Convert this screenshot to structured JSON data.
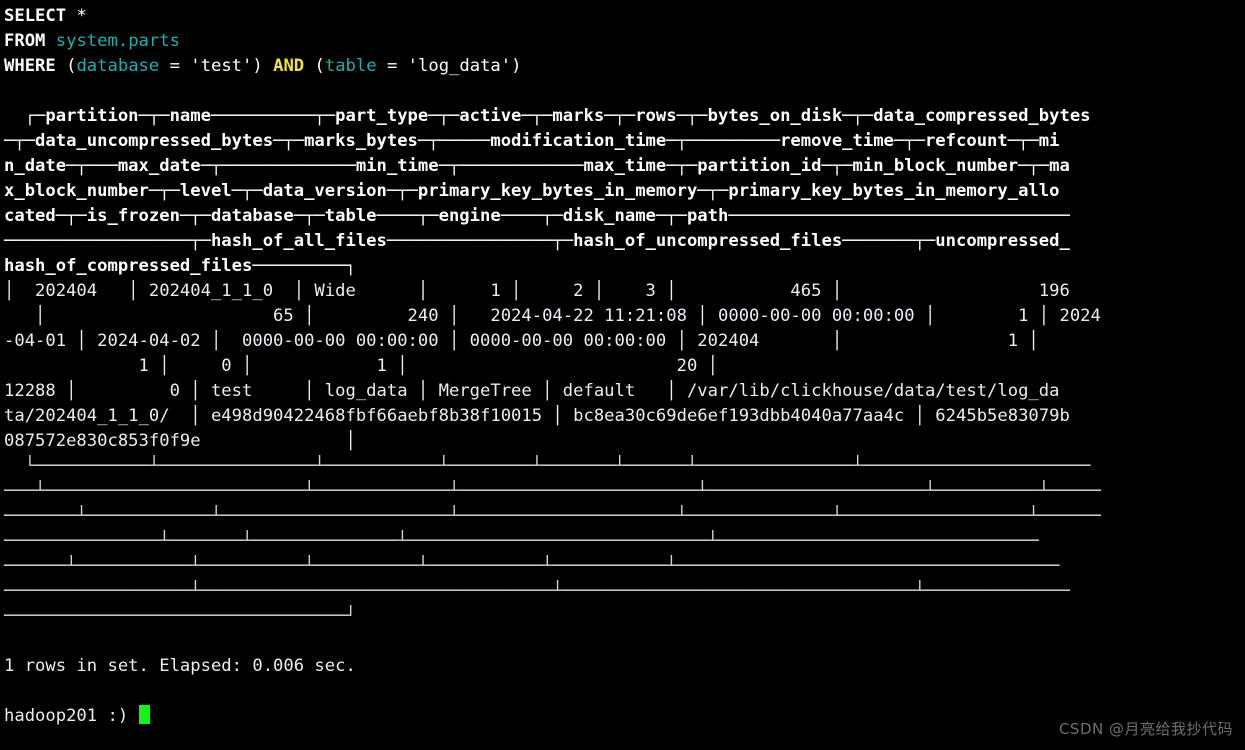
{
  "terminal": {
    "background_color": "#000000",
    "foreground_color": "#e6e6e6",
    "cursor_color": "#12f712",
    "keyword_color": "#ffffff",
    "identifier_color": "#19b0b0",
    "operator_color": "#f2e43c",
    "number_color": "#c9d6e8"
  },
  "query": {
    "line1": {
      "keyword": "SELECT",
      "rest": " *"
    },
    "line2": {
      "keyword": "FROM",
      "table": "system.parts"
    },
    "line3": {
      "keyword": "WHERE",
      "open1": " (",
      "col1": "database",
      "eq1": " = 'test')",
      "and": "AND",
      "open2": "(",
      "col2": "table",
      "eq2": " = 'log_data')"
    }
  },
  "result_header": {
    "line1": "  ┌─partition─┬─name──────────┬─part_type─┬─active─┬─marks─┬─rows─┬─bytes_on_disk─┬─data_compressed_bytes",
    "line2": "─┬─data_uncompressed_bytes─┬─marks_bytes─┬─────modification_time─┬─────────remove_time─┬─refcount─┬─mi",
    "line3": "n_date─┬───max_date─┬─────────────min_time─┬────────────max_time─┬─partition_id─┬─min_block_number─┬─ma",
    "line4": "x_block_number─┬─level─┬─data_version─┬─primary_key_bytes_in_memory─┬─primary_key_bytes_in_memory_allo",
    "line5": "cated─┬─is_frozen─┬─database─┬─table────┬─engine────┬─disk_name─┬─path─────────────────────────────────",
    "line6": "──────────────────┬─hash_of_all_files────────────────┬─hash_of_uncompressed_files───────┬─uncompressed_",
    "line7": "hash_of_compressed_files─────────┐"
  },
  "result_row": {
    "line1": "│  202404   │ 202404_1_1_0  │ Wide      │      1 │     2 │    3 │           465 │                   196",
    "line2": "   │                      65 │         240 │   2024-04-22 11:21:08 │ 0000-00-00 00:00:00 │        1 │ 2024",
    "line3": "-04-01 │ 2024-04-02 │  0000-00-00 00:00:00 │ 0000-00-00 00:00:00 │ 202404       │                1 │",
    "line4": "             1 │     0 │            1 │                          20 │",
    "line5": "12288 │         0 │ test     │ log_data │ MergeTree │ default   │ /var/lib/clickhouse/data/test/log_da",
    "line6": "ta/202404_1_1_0/  │ e498d90422468fbf66aebf8b38f10015 │ bc8ea30c69de6ef193dbb4040a77aa4c │ 6245b5e83079b",
    "line7": "087572e830c853f0f9e              │"
  },
  "result_footer": {
    "line1": "  └───────────┴───────────────┴───────────┴────────┴───────┴──────┴───────────────┴──────────────────────",
    "line2": "───┴─────────────────────────┴─────────────┴───────────────────────┴─────────────────────┴──────────┴─────",
    "line3": "───────┴────────────┴──────────────────────┴─────────────────────┴──────────────┴──────────────────┴──────",
    "line4": "───────────────┴───────┴──────────────┴─────────────────────────────┴───────────────────────────────",
    "line5": "──────┴───────────┴──────────┴──────────┴───────────┴───────────┴─────────────────────────────────────",
    "line6": "──────────────────┴──────────────────────────────────┴──────────────────────────────────┴──────────────",
    "line7": "─────────────────────────────────┘"
  },
  "status": {
    "text": "1 rows in set. Elapsed: 0.006 sec.",
    "rows": "1",
    "elapsed_sec": "0.006"
  },
  "prompt": {
    "host": "hadoop201",
    "symbol": ":)",
    "text": "hadoop201 :) "
  },
  "watermark": {
    "text": "CSDN @月亮给我抄代码"
  }
}
